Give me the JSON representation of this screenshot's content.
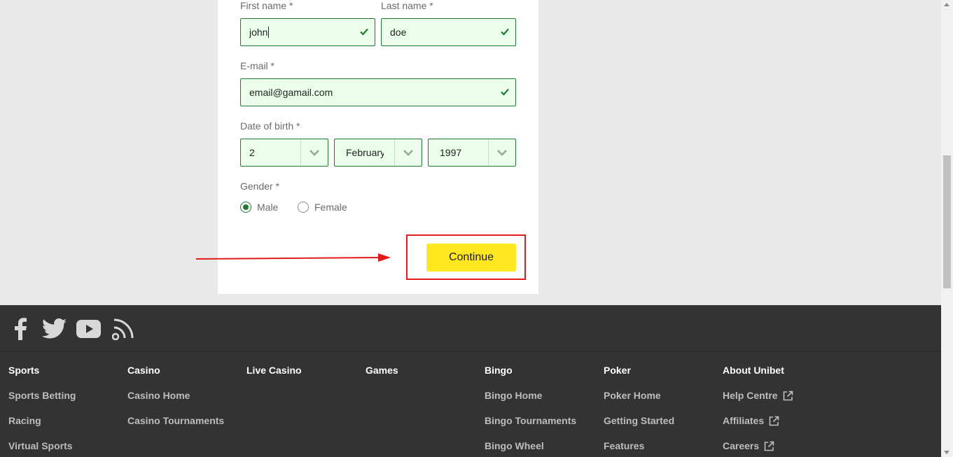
{
  "form": {
    "first_name_label": "First name *",
    "first_name_value": "john",
    "last_name_label": "Last name *",
    "last_name_value": "doe",
    "email_label": "E-mail *",
    "email_value": "email@gamail.com",
    "dob_label": "Date of birth *",
    "dob_day": "2",
    "dob_month": "February",
    "dob_year": "1997",
    "gender_label": "Gender *",
    "gender_options": [
      "Male",
      "Female"
    ],
    "gender_selected": "Male",
    "continue_label": "Continue"
  },
  "footer": {
    "social_icons": [
      "facebook-icon",
      "twitter-icon",
      "youtube-icon",
      "rss-icon"
    ],
    "columns": [
      {
        "heading": "Sports",
        "links": [
          {
            "label": "Sports Betting"
          },
          {
            "label": "Racing"
          },
          {
            "label": "Virtual Sports"
          }
        ]
      },
      {
        "heading": "Casino",
        "links": [
          {
            "label": "Casino Home"
          },
          {
            "label": "Casino Tournaments"
          }
        ]
      },
      {
        "heading": "Live Casino",
        "links": []
      },
      {
        "heading": "Games",
        "links": []
      },
      {
        "heading": "Bingo",
        "links": [
          {
            "label": "Bingo Home"
          },
          {
            "label": "Bingo Tournaments"
          },
          {
            "label": "Bingo Wheel"
          }
        ]
      },
      {
        "heading": "Poker",
        "links": [
          {
            "label": "Poker Home"
          },
          {
            "label": "Getting Started"
          },
          {
            "label": "Features"
          }
        ]
      },
      {
        "heading": "About Unibet",
        "links": [
          {
            "label": "Help Centre",
            "external": true
          },
          {
            "label": "Affiliates",
            "external": true
          },
          {
            "label": "Careers",
            "external": true
          }
        ]
      }
    ]
  },
  "colors": {
    "field_bg": "#ebfdeb",
    "field_border": "#1f7a33",
    "button_yellow": "#ffe81f",
    "footer_bg": "#333333",
    "annotation_red": "#e21a1a"
  }
}
